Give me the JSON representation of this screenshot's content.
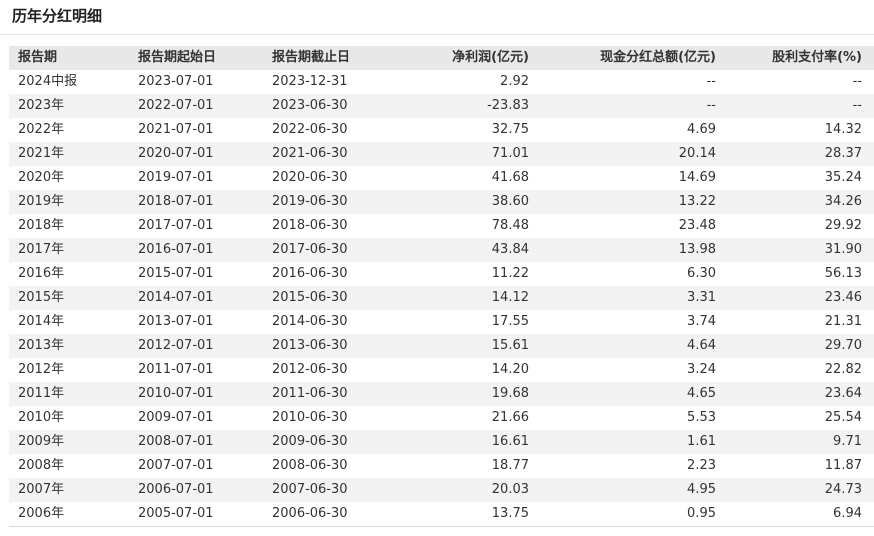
{
  "title": "历年分红明细",
  "table": {
    "headers": [
      "报告期",
      "报告期起始日",
      "报告期截止日",
      "净利润(亿元)",
      "现金分红总额(亿元)",
      "股利支付率(%)"
    ],
    "rows": [
      [
        "2024中报",
        "2023-07-01",
        "2023-12-31",
        "2.92",
        "--",
        "--"
      ],
      [
        "2023年",
        "2022-07-01",
        "2023-06-30",
        "-23.83",
        "--",
        "--"
      ],
      [
        "2022年",
        "2021-07-01",
        "2022-06-30",
        "32.75",
        "4.69",
        "14.32"
      ],
      [
        "2021年",
        "2020-07-01",
        "2021-06-30",
        "71.01",
        "20.14",
        "28.37"
      ],
      [
        "2020年",
        "2019-07-01",
        "2020-06-30",
        "41.68",
        "14.69",
        "35.24"
      ],
      [
        "2019年",
        "2018-07-01",
        "2019-06-30",
        "38.60",
        "13.22",
        "34.26"
      ],
      [
        "2018年",
        "2017-07-01",
        "2018-06-30",
        "78.48",
        "23.48",
        "29.92"
      ],
      [
        "2017年",
        "2016-07-01",
        "2017-06-30",
        "43.84",
        "13.98",
        "31.90"
      ],
      [
        "2016年",
        "2015-07-01",
        "2016-06-30",
        "11.22",
        "6.30",
        "56.13"
      ],
      [
        "2015年",
        "2014-07-01",
        "2015-06-30",
        "14.12",
        "3.31",
        "23.46"
      ],
      [
        "2014年",
        "2013-07-01",
        "2014-06-30",
        "17.55",
        "3.74",
        "21.31"
      ],
      [
        "2013年",
        "2012-07-01",
        "2013-06-30",
        "15.61",
        "4.64",
        "29.70"
      ],
      [
        "2012年",
        "2011-07-01",
        "2012-06-30",
        "14.20",
        "3.24",
        "22.82"
      ],
      [
        "2011年",
        "2010-07-01",
        "2011-06-30",
        "19.68",
        "4.65",
        "23.64"
      ],
      [
        "2010年",
        "2009-07-01",
        "2010-06-30",
        "21.66",
        "5.53",
        "25.54"
      ],
      [
        "2009年",
        "2008-07-01",
        "2009-06-30",
        "16.61",
        "1.61",
        "9.71"
      ],
      [
        "2008年",
        "2007-07-01",
        "2008-06-30",
        "18.77",
        "2.23",
        "11.87"
      ],
      [
        "2007年",
        "2006-07-01",
        "2007-06-30",
        "20.03",
        "4.95",
        "24.73"
      ],
      [
        "2006年",
        "2005-07-01",
        "2006-06-30",
        "13.75",
        "0.95",
        "6.94"
      ]
    ]
  }
}
